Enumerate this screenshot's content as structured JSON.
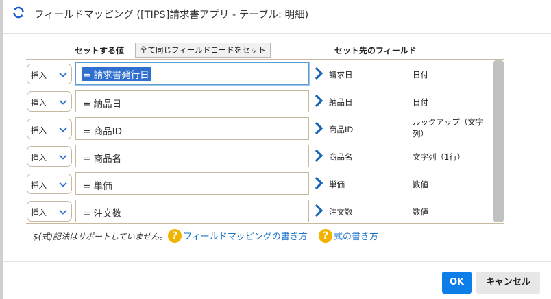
{
  "dialog": {
    "title": "フィールドマッピング ([TIPS]請求書アプリ - テーブル: 明細)",
    "refresh_icon": "refresh-icon"
  },
  "headers": {
    "set_value": "セットする値",
    "set_all_button": "全て同じフィールドコードをセット",
    "target_field": "セット先のフィールド"
  },
  "rows": [
    {
      "operation": "挿入",
      "value": "= 請求書発行日",
      "target_field": "請求日",
      "target_type": "日付"
    },
    {
      "operation": "挿入",
      "value": "= 納品日",
      "target_field": "納品日",
      "target_type": "日付"
    },
    {
      "operation": "挿入",
      "value": "= 商品ID",
      "target_field": "商品ID",
      "target_type": "ルックアップ（文字列）"
    },
    {
      "operation": "挿入",
      "value": "= 商品名",
      "target_field": "商品名",
      "target_type": "文字列（1行）"
    },
    {
      "operation": "挿入",
      "value": "= 単価",
      "target_field": "単価",
      "target_type": "数値"
    },
    {
      "operation": "挿入",
      "value": "= 注文数",
      "target_field": "注文数",
      "target_type": "数値"
    }
  ],
  "footer": {
    "note": "$(式)記法はサポートしていません。",
    "help_mapping": "フィールドマッピングの書き方",
    "help_formula": "式の書き方",
    "help_icon_glyph": "?"
  },
  "buttons": {
    "ok": "OK",
    "cancel": "キャンセル"
  },
  "colors": {
    "accent": "#0d7de8",
    "link": "#1a73c9",
    "help_icon": "#f2b200",
    "selection": "#2f6fcf",
    "border": "#c8b79f"
  }
}
